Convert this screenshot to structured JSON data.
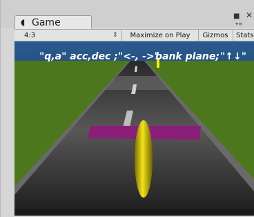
{
  "window": {
    "tab_icon": "unity-game-icon",
    "tab_icon_glyph": "◖",
    "tab_label": "Game",
    "maximize_glyph": "■",
    "close_glyph": "✕",
    "menu_glyph": "▾≡"
  },
  "toolbar": {
    "aspect": "4:3",
    "aspect_arrow": "⇕",
    "maximize_on_play": "Maximize on Play",
    "gizmos": "Gizmos",
    "stats": "Stats"
  },
  "hud": {
    "instruction_1": "\"q,a\" acc,dec ;",
    "instruction_2": "\"<-, ->\"",
    "instruction_3": "bank plane;",
    "instruction_4": "\"↑↓\""
  },
  "scene": {
    "sky_color": "#2a5a8e",
    "grass_color": "#4f7a1e",
    "road_color": "#3c3c3c",
    "wing_color": "#8a1f78",
    "fuselage_color": "#d6c100",
    "marker_color": "#f2ea2a"
  }
}
